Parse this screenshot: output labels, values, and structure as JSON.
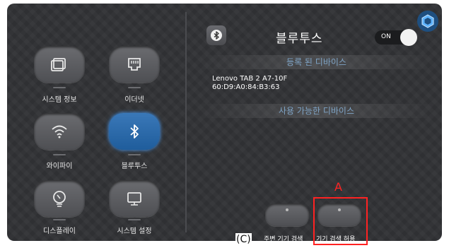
{
  "left_menu": {
    "items": [
      {
        "label": "시스템 정보",
        "icon": "system-info-icon"
      },
      {
        "label": "이더넷",
        "icon": "ethernet-icon"
      },
      {
        "label": "와이파이",
        "icon": "wifi-icon"
      },
      {
        "label": "블루투스",
        "icon": "bluetooth-icon",
        "active": true
      },
      {
        "label": "디스플레이",
        "icon": "display-icon"
      },
      {
        "label": "시스템 설정",
        "icon": "system-settings-icon"
      }
    ]
  },
  "bluetooth": {
    "title": "블루투스",
    "toggle_label": "ON",
    "paired_header": "등록 된 디바이스",
    "paired_device": {
      "name": "Lenovo TAB 2 A7-10F",
      "mac": "60:D9:A0:84:B3:63"
    },
    "available_header": "사용 가능한 디바이스",
    "scan_label": "주변 기기 검색",
    "allow_label": "기기 검색 허용"
  },
  "annotations": {
    "a": "A",
    "c": "(C)"
  },
  "colors": {
    "accent": "#2f6fae",
    "annotation": "#ff2222"
  }
}
